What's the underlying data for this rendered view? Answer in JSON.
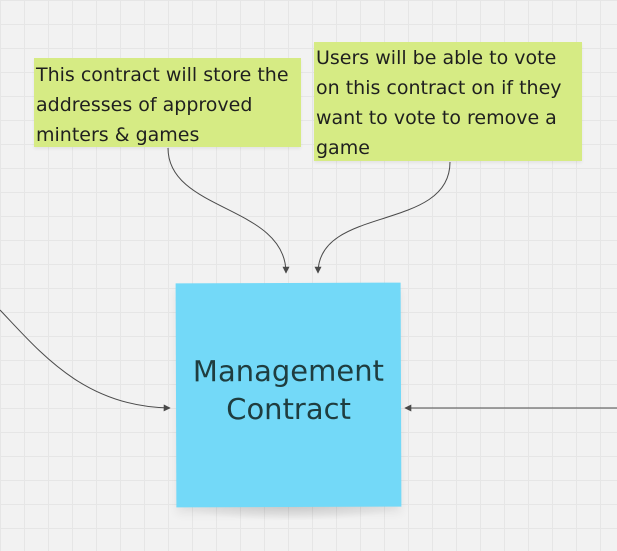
{
  "board": {
    "notes": [
      {
        "id": "approved-minters-games",
        "text": "This contract will store the addresses of approved minters & games",
        "color": "#d6eb84"
      },
      {
        "id": "vote-remove-game",
        "text": "Users will be able to vote on this contract on if they want to vote to remove a game",
        "color": "#d6eb84"
      }
    ],
    "sticky": {
      "text": "Management\nContract",
      "color": "#73d9f8"
    }
  }
}
